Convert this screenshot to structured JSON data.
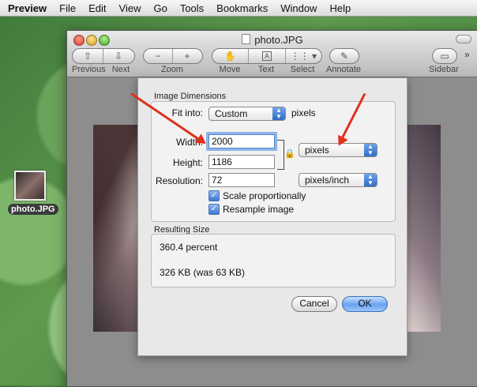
{
  "menubar": {
    "items": [
      "Preview",
      "File",
      "Edit",
      "View",
      "Go",
      "Tools",
      "Bookmarks",
      "Window",
      "Help"
    ]
  },
  "desktop": {
    "file_label": "photo.JPG"
  },
  "window": {
    "title": "photo.JPG",
    "toolbar": {
      "previous": "Previous",
      "next": "Next",
      "zoom": "Zoom",
      "move": "Move",
      "text": "Text",
      "select": "Select",
      "annotate": "Annotate",
      "sidebar": "Sidebar"
    }
  },
  "dialog": {
    "image_dimensions_title": "Image Dimensions",
    "fit_into_label": "Fit into:",
    "fit_into_value": "Custom",
    "fit_into_unit": "pixels",
    "width_label": "Width:",
    "width_value": "2000",
    "height_label": "Height:",
    "height_value": "1186",
    "size_unit_value": "pixels",
    "resolution_label": "Resolution:",
    "resolution_value": "72",
    "resolution_unit_value": "pixels/inch",
    "scale_proportionally": "Scale proportionally",
    "resample_image": "Resample image",
    "resulting_size_title": "Resulting Size",
    "percent_text": "360.4 percent",
    "filesize_text": "326 KB (was 63 KB)",
    "cancel_label": "Cancel",
    "ok_label": "OK"
  }
}
